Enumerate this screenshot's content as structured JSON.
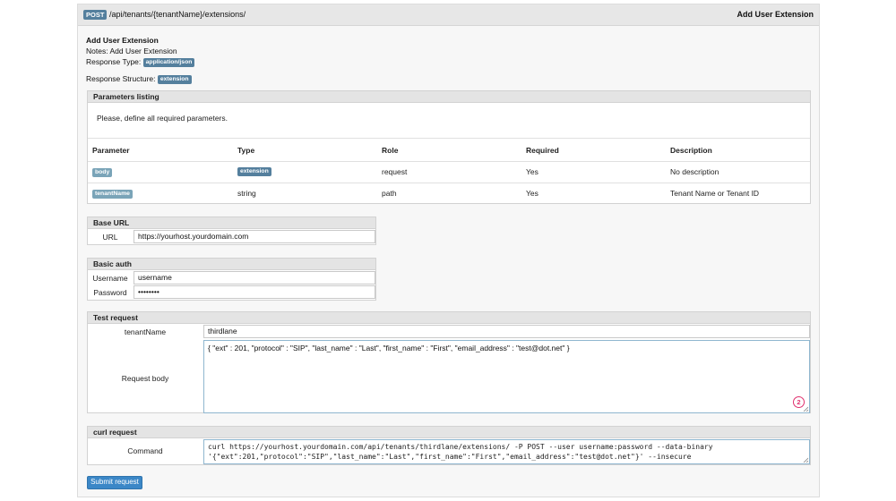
{
  "header": {
    "method": "POST",
    "path": "/api/tenants/{tenantName}/extensions/",
    "title": "Add User Extension"
  },
  "summary": {
    "heading": "Add User Extension",
    "notes": "Notes: Add User Extension",
    "response_type_label": "Response Type:",
    "response_type_value": "application/json",
    "response_structure_label": "Response Structure:",
    "response_structure_value": "extension"
  },
  "parameters": {
    "title": "Parameters listing",
    "hint": "Please, define all required parameters.",
    "columns": [
      "Parameter",
      "Type",
      "Role",
      "Required",
      "Description"
    ],
    "rows": [
      {
        "name": "body",
        "type": "extension",
        "role": "request",
        "required": "Yes",
        "description": "No description"
      },
      {
        "name": "tenantName",
        "type": "string",
        "role": "path",
        "required": "Yes",
        "description": "Tenant Name or Tenant ID"
      }
    ]
  },
  "base_url": {
    "title": "Base URL",
    "label": "URL",
    "value": "https://yourhost.yourdomain.com"
  },
  "basic_auth": {
    "title": "Basic auth",
    "username_label": "Username",
    "username_value": "username",
    "password_label": "Password",
    "password_value": "••••••••"
  },
  "test_request": {
    "title": "Test request",
    "tenant_label": "tenantName",
    "tenant_value": "thirdlane",
    "body_label": "Request body",
    "body_value": "{ \"ext\" : 201, \"protocol\" : \"SIP\", \"last_name\" : \"Last\", \"first_name\" : \"First\", \"email_address\" : \"test@dot.net\" }",
    "marker": "2"
  },
  "curl": {
    "title": "curl request",
    "label": "Command",
    "line1": "curl https://yourhost.yourdomain.com/api/tenants/thirdlane/extensions/ -P POST --user username:password --data-binary",
    "line2": "'{\"ext\":201,\"protocol\":\"SIP\",\"last_name\":\"Last\",\"first_name\":\"First\",\"email_address\":\"test@dot.net\"}' --insecure"
  },
  "submit": {
    "label": "Submit request"
  },
  "colors": {
    "badge": "#547f9d",
    "badge_light": "#7aa4b8",
    "button": "#3b87c7",
    "marker": "#e0306e"
  }
}
